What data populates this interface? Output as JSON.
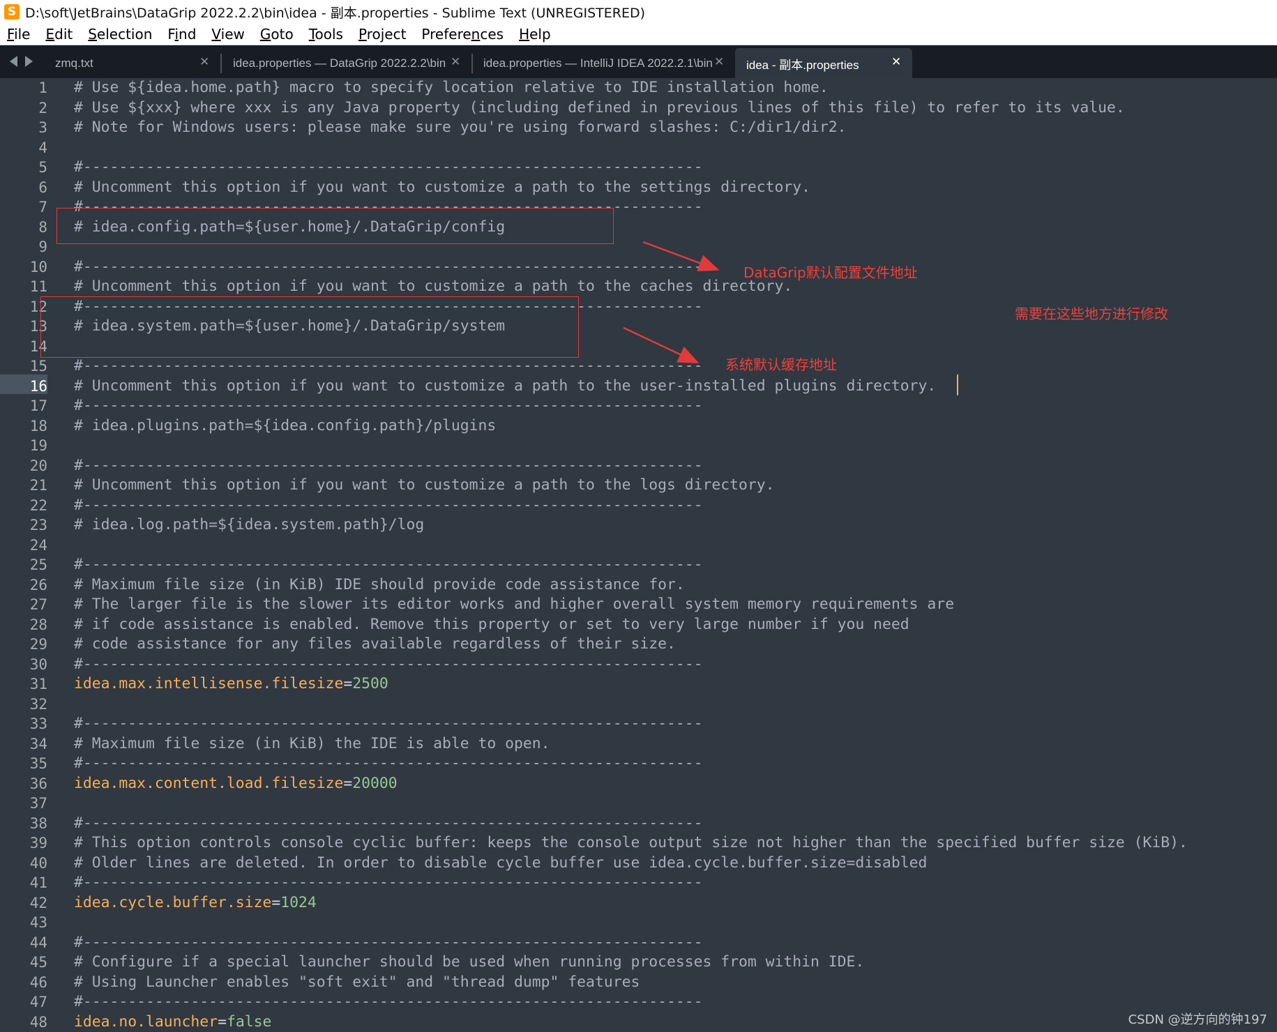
{
  "window": {
    "title": "D:\\soft\\JetBrains\\DataGrip 2022.2.2\\bin\\idea - 副本.properties - Sublime Text (UNREGISTERED)",
    "app_icon": "sublime-text-logo"
  },
  "menu": {
    "items": [
      {
        "label": "File",
        "underline": "F",
        "rest": "ile"
      },
      {
        "label": "Edit",
        "underline": "E",
        "rest": "dit"
      },
      {
        "label": "Selection",
        "underline": "S",
        "rest": "election"
      },
      {
        "label": "Find",
        "underline": "F",
        "rest": "ind",
        "underline_first": false,
        "pre": "F",
        "u": "i",
        "post": "nd"
      },
      {
        "label": "View",
        "underline": "V",
        "rest": "iew"
      },
      {
        "label": "Goto",
        "underline": "G",
        "rest": "oto"
      },
      {
        "label": "Tools",
        "underline": "T",
        "rest": "ools"
      },
      {
        "label": "Project",
        "underline": "P",
        "rest": "roject"
      },
      {
        "label": "Preferences",
        "underline": "n",
        "rest": ""
      },
      {
        "label": "Help",
        "underline": "H",
        "rest": "elp"
      }
    ]
  },
  "tabs": [
    {
      "label": "zmq.txt",
      "active": false
    },
    {
      "label": "idea.properties — DataGrip 2022.2.2\\bin",
      "active": false
    },
    {
      "label": "idea.properties — IntelliJ IDEA 2022.2.1\\bin",
      "active": false
    },
    {
      "label": "idea - 副本.properties",
      "active": true
    }
  ],
  "editor": {
    "current_line": 16,
    "lines": [
      {
        "n": "1",
        "type": "comment",
        "text": "# Use ${idea.home.path} macro to specify location relative to IDE installation home."
      },
      {
        "n": "2",
        "type": "comment",
        "text": "# Use ${xxx} where xxx is any Java property (including defined in previous lines of this file) to refer to its value."
      },
      {
        "n": "3",
        "type": "comment",
        "text": "# Note for Windows users: please make sure you're using forward slashes: C:/dir1/dir2."
      },
      {
        "n": "4",
        "type": "blank",
        "text": ""
      },
      {
        "n": "5",
        "type": "comment",
        "text": "#---------------------------------------------------------------------"
      },
      {
        "n": "6",
        "type": "comment",
        "text": "# Uncomment this option if you want to customize a path to the settings directory."
      },
      {
        "n": "7",
        "type": "comment",
        "text": "#---------------------------------------------------------------------"
      },
      {
        "n": "8",
        "type": "comment",
        "text": "# idea.config.path=${user.home}/.DataGrip/config"
      },
      {
        "n": "9",
        "type": "blank",
        "text": ""
      },
      {
        "n": "10",
        "type": "comment",
        "text": "#---------------------------------------------------------------------"
      },
      {
        "n": "11",
        "type": "comment",
        "text": "# Uncomment this option if you want to customize a path to the caches directory."
      },
      {
        "n": "12",
        "type": "comment",
        "text": "#---------------------------------------------------------------------"
      },
      {
        "n": "13",
        "type": "comment",
        "text": "# idea.system.path=${user.home}/.DataGrip/system"
      },
      {
        "n": "14",
        "type": "blank",
        "text": ""
      },
      {
        "n": "15",
        "type": "comment",
        "text": "#---------------------------------------------------------------------"
      },
      {
        "n": "16",
        "type": "comment",
        "text": "# Uncomment this option if you want to customize a path to the user-installed plugins directory."
      },
      {
        "n": "17",
        "type": "comment",
        "text": "#---------------------------------------------------------------------"
      },
      {
        "n": "18",
        "type": "comment",
        "text": "# idea.plugins.path=${idea.config.path}/plugins"
      },
      {
        "n": "19",
        "type": "blank",
        "text": ""
      },
      {
        "n": "20",
        "type": "comment",
        "text": "#---------------------------------------------------------------------"
      },
      {
        "n": "21",
        "type": "comment",
        "text": "# Uncomment this option if you want to customize a path to the logs directory."
      },
      {
        "n": "22",
        "type": "comment",
        "text": "#---------------------------------------------------------------------"
      },
      {
        "n": "23",
        "type": "comment",
        "text": "# idea.log.path=${idea.system.path}/log"
      },
      {
        "n": "24",
        "type": "blank",
        "text": ""
      },
      {
        "n": "25",
        "type": "comment",
        "text": "#---------------------------------------------------------------------"
      },
      {
        "n": "26",
        "type": "comment",
        "text": "# Maximum file size (in KiB) IDE should provide code assistance for."
      },
      {
        "n": "27",
        "type": "comment",
        "text": "# The larger file is the slower its editor works and higher overall system memory requirements are"
      },
      {
        "n": "28",
        "type": "comment",
        "text": "# if code assistance is enabled. Remove this property or set to very large number if you need"
      },
      {
        "n": "29",
        "type": "comment",
        "text": "# code assistance for any files available regardless of their size."
      },
      {
        "n": "30",
        "type": "comment",
        "text": "#---------------------------------------------------------------------"
      },
      {
        "n": "31",
        "type": "prop",
        "key": "idea.max.intellisense.filesize",
        "eq": "=",
        "val": "2500"
      },
      {
        "n": "32",
        "type": "blank",
        "text": ""
      },
      {
        "n": "33",
        "type": "comment",
        "text": "#---------------------------------------------------------------------"
      },
      {
        "n": "34",
        "type": "comment",
        "text": "# Maximum file size (in KiB) the IDE is able to open."
      },
      {
        "n": "35",
        "type": "comment",
        "text": "#---------------------------------------------------------------------"
      },
      {
        "n": "36",
        "type": "prop",
        "key": "idea.max.content.load.filesize",
        "eq": "=",
        "val": "20000"
      },
      {
        "n": "37",
        "type": "blank",
        "text": ""
      },
      {
        "n": "38",
        "type": "comment",
        "text": "#---------------------------------------------------------------------"
      },
      {
        "n": "39",
        "type": "comment",
        "text": "# This option controls console cyclic buffer: keeps the console output size not higher than the specified buffer size (KiB)."
      },
      {
        "n": "40",
        "type": "comment",
        "text": "# Older lines are deleted. In order to disable cycle buffer use idea.cycle.buffer.size=disabled"
      },
      {
        "n": "41",
        "type": "comment",
        "text": "#---------------------------------------------------------------------"
      },
      {
        "n": "42",
        "type": "prop",
        "key": "idea.cycle.buffer.size",
        "eq": "=",
        "val": "1024"
      },
      {
        "n": "43",
        "type": "blank",
        "text": ""
      },
      {
        "n": "44",
        "type": "comment",
        "text": "#---------------------------------------------------------------------"
      },
      {
        "n": "45",
        "type": "comment",
        "text": "# Configure if a special launcher should be used when running processes from within IDE."
      },
      {
        "n": "46",
        "type": "comment",
        "text": "# Using Launcher enables \"soft exit\" and \"thread dump\" features"
      },
      {
        "n": "47",
        "type": "comment",
        "text": "#---------------------------------------------------------------------"
      },
      {
        "n": "48",
        "type": "prop",
        "key": "idea.no.launcher",
        "eq": "=",
        "val": "false"
      }
    ]
  },
  "annotations": {
    "config_label": "DataGrip默认配置文件地址",
    "system_label": "系统默认缓存地址",
    "note_label": "需要在这些地方进行修改"
  },
  "watermark": "CSDN @逆方向的钟197",
  "colors": {
    "editor_bg": "#303841",
    "comment": "#a7adba",
    "key": "#f9ae58",
    "value": "#99c794",
    "annotation_red": "#f0403a"
  }
}
